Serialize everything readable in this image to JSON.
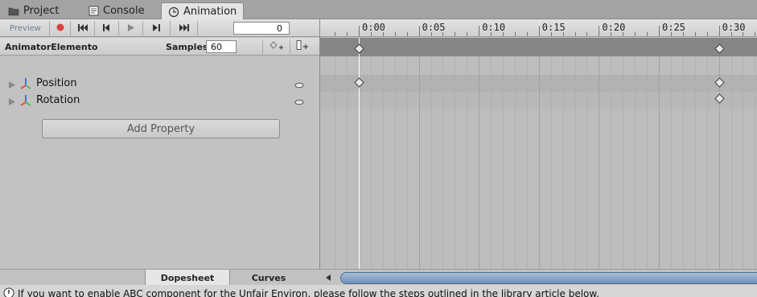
{
  "tabs": [
    {
      "label": "Project",
      "icon": "folder-icon"
    },
    {
      "label": "Console",
      "icon": "console-icon"
    },
    {
      "label": "Animation",
      "icon": "clock-icon",
      "active": true
    }
  ],
  "toolbar": {
    "preview_label": "Preview",
    "record_color": "#d9423f",
    "frame_value": "0"
  },
  "clip": {
    "name": "AnimatorElemento",
    "samples_label": "Samples",
    "samples_value": "60"
  },
  "properties": [
    {
      "name": "Position"
    },
    {
      "name": "Rotation"
    }
  ],
  "add_property_label": "Add Property",
  "bottom_tabs": [
    {
      "label": "Dopesheet",
      "active": true
    },
    {
      "label": "Curves",
      "active": false
    }
  ],
  "timeline": {
    "labels": [
      "0:00",
      "0:05",
      "0:10",
      "0:15",
      "0:20",
      "0:25",
      "0:30"
    ],
    "playhead_time": "0:00",
    "keyframe_times": [
      "0:00",
      "0:30"
    ],
    "colors": {
      "summary_band": "#868686",
      "playhead": "#ffffff",
      "key_fill": "#e8e8e8"
    }
  },
  "info": {
    "text": "If you want to enable ABC component for the Unfair Environ, please follow the steps outlined in the library article below."
  }
}
